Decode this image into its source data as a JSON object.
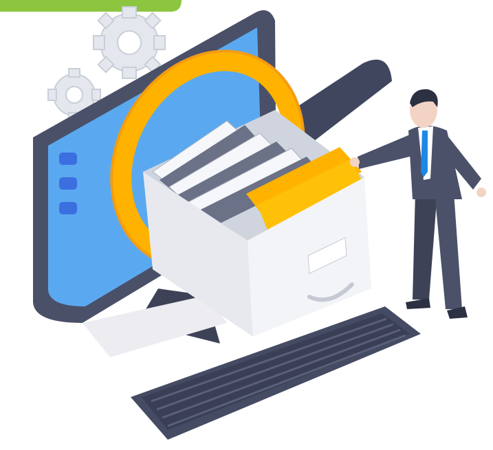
{
  "illustration": {
    "colors": {
      "banner": "#8cc63f",
      "monitor_frame": "#4a5068",
      "screen": "#5aa9f0",
      "magnifier_ring": "#ffb300",
      "magnifier_handle": "#3f465e",
      "folder": "#ffc107",
      "drawer": "#eef0f4",
      "keyboard": "#454b63",
      "gear": "#e3e6ec",
      "suit": "#4b5169",
      "tie": "#1e88e5",
      "skin": "#f2d3c4"
    }
  }
}
